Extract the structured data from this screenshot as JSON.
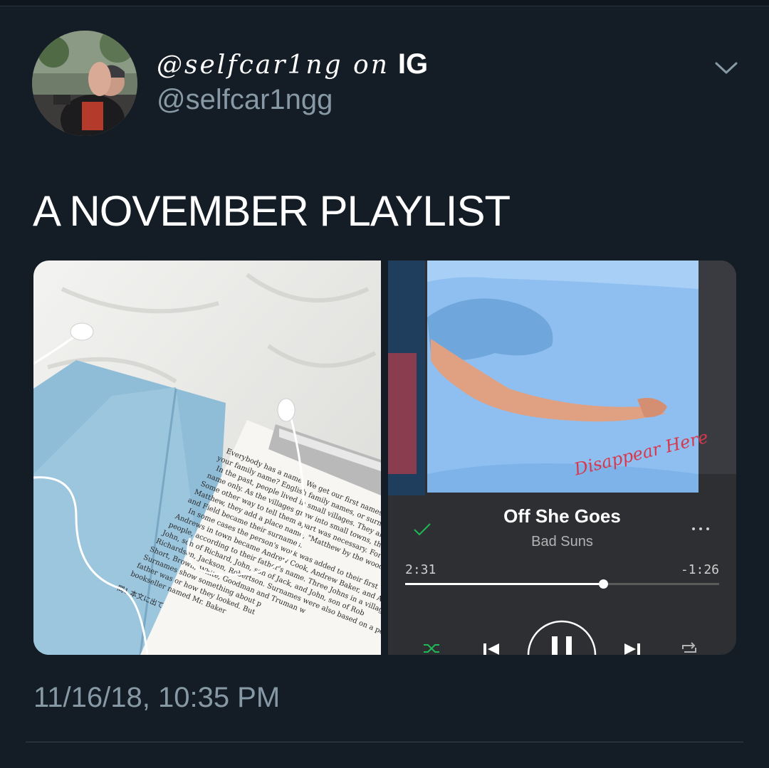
{
  "tweet": {
    "display_name_script": "@selfcar1ng on",
    "display_name_suffix": "IG",
    "handle": "@selfcar1ngg",
    "text": "A NOVEMBER PLAYLIST",
    "timestamp": "11/16/18, 10:35 PM"
  },
  "player": {
    "track_title": "Off She Goes",
    "artist": "Bad Suns",
    "album_art_text": "Disappear Here",
    "time_elapsed": "2:31",
    "time_remaining": "-1:26",
    "progress": 0.63,
    "accent_color": "#1db954"
  },
  "book": {
    "lines": [
      "Everybody has a name. We get our first names w",
      "your family name? English family names, or surnames",
      "In the past, people lived in small villages. They all",
      "name only. As the villages grew into small towns, they fou",
      "Some other way to tell them apart was necessary. For exa",
      "Matthew, they add a place name, \"Matthew by the wood\" or",
      "and Field became their surnames.",
      "In some cases the person's work was added to their first",
      "Andrews in town became Andrew Cook, Andrew Baker, and A",
      "people, according to their father's name. Three Johns in a villag",
      "John, son of Richard, John, son of Jack, and John, son of Rob",
      "Richardson, Jackson, Robertson. Surnames were also based on a person",
      "Short, Brown, White, Goodman and Truman w",
      "Surnames show something about p",
      "father was or how they looked. But",
      "bookseller named Mr. Baker"
    ],
    "question": "問1  本文に出て"
  }
}
